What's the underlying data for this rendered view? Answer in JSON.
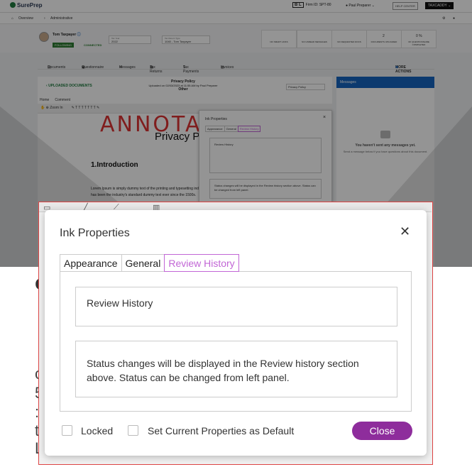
{
  "app": {
    "logo": "SurePrep",
    "firm_badge": "B L",
    "firm_id": "Firm ID: SPT-80",
    "user": "Paul Preparer",
    "help_center": "HELP CENTER",
    "taxcaddy": "TAXCADDY"
  },
  "nav": {
    "overview": "Overview",
    "administrative": "Administrative"
  },
  "client": {
    "name": "Tom Taxpayer",
    "following": "FOLLOWING",
    "connected": "CONNECTED",
    "tax_year_label": "Tax Year",
    "tax_year": "2022",
    "tax_type_label": "Tax Return Type",
    "tax_type": "1040 - Tom Taxpayer"
  },
  "stats": [
    {
      "value": "",
      "label": "NO SMART LINKS"
    },
    {
      "value": "",
      "label": "NO UNREAD MESSAGES"
    },
    {
      "value": "",
      "label": "NO REQUESTED DOCS"
    },
    {
      "value": "2",
      "label": "DOCUMENTS UPLOADED"
    },
    {
      "value": "0 %",
      "label": "OF QUESTIONNAIRE COMPLETED"
    }
  ],
  "tabs": {
    "documents": "Documents",
    "questionnaire": "Questionnaire",
    "messages": "Messages",
    "tax_returns": "Tax Returns",
    "tax_payments": "Tax Payments",
    "invoices": "Invoices",
    "more_actions": "MORE ACTIONS"
  },
  "document": {
    "back": "UPLOADED DOCUMENTS",
    "title": "Privacy Policy",
    "uploaded": "Uploaded on 02/03/2023 at 11:55 AM by Paul Preparer",
    "category": "Other",
    "selector": "Privacy Policy",
    "home_tab": "Home",
    "comment_tab": "Comment",
    "zoom": "Zoom In",
    "annotation": "ANNOTA",
    "heading": "Privacy P",
    "section": "1.Introduction",
    "lorem": "Lorem Ipsum is simply dummy text of the printing and typesetting industry. Lorem Ipsum has been the industry's standard dummy text ever since the 1500s."
  },
  "messages": {
    "header": "Messages",
    "empty": "You haven't sent any messages yet.",
    "hint": "Send a message below if you have questions about this document."
  },
  "dialog": {
    "title": "Ink Properties",
    "close_icon": "close-icon",
    "tabs": [
      "Appearance",
      "General",
      "Review History"
    ],
    "active_tab": "Review History",
    "review_history_label": "Review History",
    "status_text": "Status changes will be displayed in the Review history section above. Status can be changed from left panel.",
    "locked_label": "Locked",
    "set_default_label": "Set Current Properties as Default",
    "close_button": "Close"
  },
  "colors": {
    "accent_purple": "#8e2d9c",
    "active_tab": "#c266d6",
    "brand_green": "#1f7a3f",
    "messages_blue": "#1565c0",
    "callout_border": "#dd4444"
  }
}
